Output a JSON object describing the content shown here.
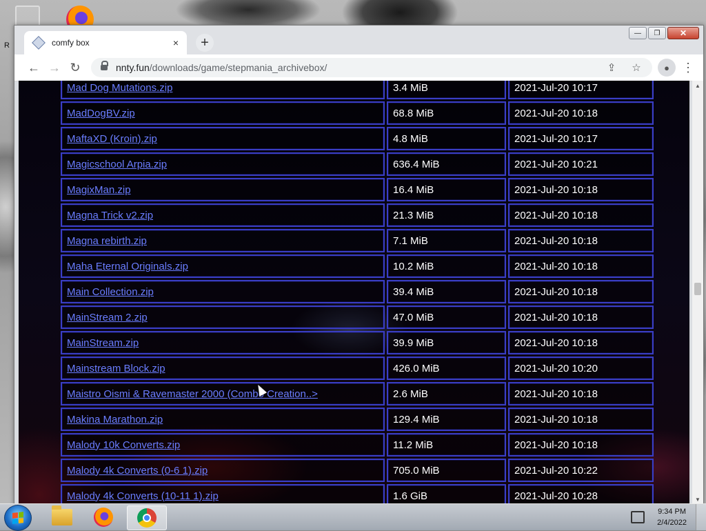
{
  "desktop": {
    "icon_label": "R"
  },
  "window": {
    "tab_title": "comfy box",
    "tab_close": "×",
    "new_tab": "+",
    "controls": {
      "minimize": "—",
      "maximize": "❐",
      "close": "✕"
    }
  },
  "toolbar": {
    "back": "←",
    "forward": "→",
    "reload": "↻",
    "url_host": "nnty.fun",
    "url_path": "/downloads/game/stepmania_archivebox/",
    "share": "⇪",
    "bookmark": "☆",
    "profile": "●",
    "menu": "⋮"
  },
  "files": [
    {
      "name": "Mad Dog Mutations.zip",
      "size": "3.4 MiB",
      "date": "2021-Jul-20 10:17"
    },
    {
      "name": "MadDogBV.zip",
      "size": "68.8 MiB",
      "date": "2021-Jul-20 10:18"
    },
    {
      "name": "MaftaXD (Kroin).zip",
      "size": "4.8 MiB",
      "date": "2021-Jul-20 10:17"
    },
    {
      "name": "Magicschool Arpia.zip",
      "size": "636.4 MiB",
      "date": "2021-Jul-20 10:21"
    },
    {
      "name": "MagixMan.zip",
      "size": "16.4 MiB",
      "date": "2021-Jul-20 10:18"
    },
    {
      "name": "Magna Trick v2.zip",
      "size": "21.3 MiB",
      "date": "2021-Jul-20 10:18"
    },
    {
      "name": "Magna rebirth.zip",
      "size": "7.1 MiB",
      "date": "2021-Jul-20 10:18"
    },
    {
      "name": "Maha Eternal Originals.zip",
      "size": "10.2 MiB",
      "date": "2021-Jul-20 10:18"
    },
    {
      "name": "Main Collection.zip",
      "size": "39.4 MiB",
      "date": "2021-Jul-20 10:18"
    },
    {
      "name": "MainStream 2.zip",
      "size": "47.0 MiB",
      "date": "2021-Jul-20 10:18"
    },
    {
      "name": "MainStream.zip",
      "size": "39.9 MiB",
      "date": "2021-Jul-20 10:18"
    },
    {
      "name": "Mainstream Block.zip",
      "size": "426.0 MiB",
      "date": "2021-Jul-20 10:20"
    },
    {
      "name": "Maistro Oismi & Ravemaster 2000 (Combo Creation..>",
      "size": "2.6 MiB",
      "date": "2021-Jul-20 10:18"
    },
    {
      "name": "Makina Marathon.zip",
      "size": "129.4 MiB",
      "date": "2021-Jul-20 10:18"
    },
    {
      "name": "Malody 10k Converts.zip",
      "size": "11.2 MiB",
      "date": "2021-Jul-20 10:18"
    },
    {
      "name": "Malody 4k Converts (0-6 1).zip",
      "size": "705.0 MiB",
      "date": "2021-Jul-20 10:22"
    },
    {
      "name": "Malody 4k Converts (10-11 1).zip",
      "size": "1.6 GiB",
      "date": "2021-Jul-20 10:28"
    }
  ],
  "scrollbar": {
    "up": "▲",
    "down": "▼"
  },
  "taskbar": {
    "time": "9:34 PM",
    "date": "2/4/2022"
  },
  "colors": {
    "cell_border": "#3a3ec6",
    "link": "#6a7dff",
    "page_bg": "#05030d"
  }
}
